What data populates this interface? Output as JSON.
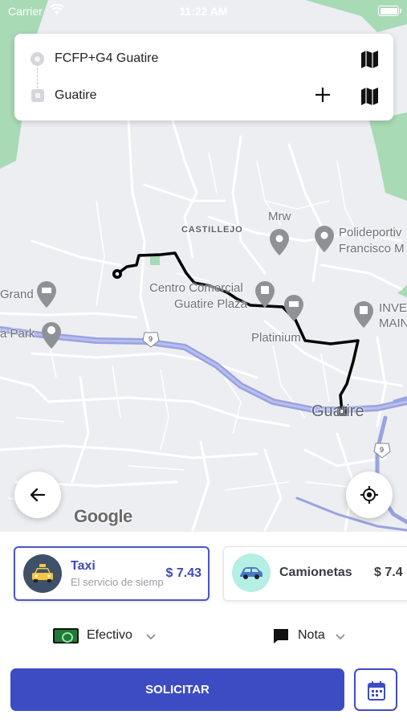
{
  "status_bar": {
    "carrier": "Carrier",
    "time": "11:22 AM"
  },
  "route": {
    "origin": "FCFP+G4 Guatire",
    "destination": "Guatire"
  },
  "map": {
    "labels": {
      "castillejo": "CASTILLEJO",
      "mrw": "Mrw",
      "polideportivo_1": "Polideportiv",
      "polideportivo_2": "Francisco M",
      "grand": "Grand",
      "centro_1": "Centro Comercial",
      "centro_2": "Guatire Plaza",
      "platinium": "Platinium",
      "inver_1": "INVE",
      "inver_2": "MAIN",
      "park": "a Park",
      "guatire": "Guatire",
      "road_9a": "9",
      "road_9b": "9"
    },
    "attribution": "Google"
  },
  "services": [
    {
      "name": "Taxi",
      "description": "El servicio de siempre",
      "price": "$ 7.43",
      "selected": true,
      "icon": "taxi-icon"
    },
    {
      "name": "Camionetas",
      "description": "",
      "price": "$ 7.4",
      "selected": false,
      "icon": "car-icon"
    }
  ],
  "payment": {
    "label": "Efectivo",
    "icon": "cash-icon"
  },
  "note": {
    "label": "Nota",
    "icon": "note-icon"
  },
  "actions": {
    "request_label": "SOLICITAR",
    "schedule_icon": "calendar-icon"
  },
  "colors": {
    "accent": "#3e4cc4",
    "map_park": "#a8dab5",
    "highway": "#9aa3e0",
    "route": "#000000"
  }
}
